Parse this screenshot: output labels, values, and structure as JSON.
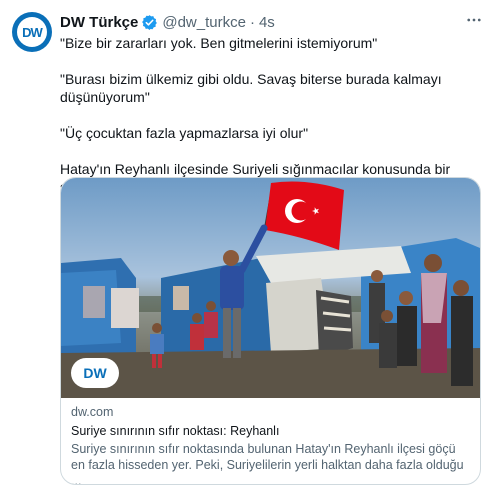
{
  "author": {
    "display_name": "DW Türkçe",
    "handle": "@dw_turkce",
    "separator": "·",
    "time": "4s",
    "avatar_text": "DW"
  },
  "tweet": {
    "lines": [
      "\"Bize bir zararları yok. Ben gitmelerini istemiyorum\"",
      "\"Burası bizim ülkemiz gibi oldu. Savaş biterse burada kalmayı düşünüyorum\"",
      "\"Üç çocuktan fazla yapmazlarsa iyi olur\"",
      "Hatay'ın Reyhanlı ilçesinde Suriyeli sığınmacılar konusunda bir sorun yaşanıyor mu?"
    ]
  },
  "card": {
    "image_logo_text": "DW",
    "domain": "dw.com",
    "title": "Suriye sınırının sıfır noktası: Reyhanlı",
    "description": "Suriye sınırının sıfır noktasında bulunan Hatay'ın Reyhanlı ilçesi göçü en fazla hisseden yer. Peki, Suriyelilerin yerli halktan daha fazla olduğu ..."
  },
  "colors": {
    "brand_blue": "#0a6fb8",
    "verified": "#1d9bf0",
    "flag_red": "#e30a17",
    "muted": "#536471"
  },
  "icons": {
    "verified": "verified-badge-icon",
    "more": "more-options-icon"
  }
}
